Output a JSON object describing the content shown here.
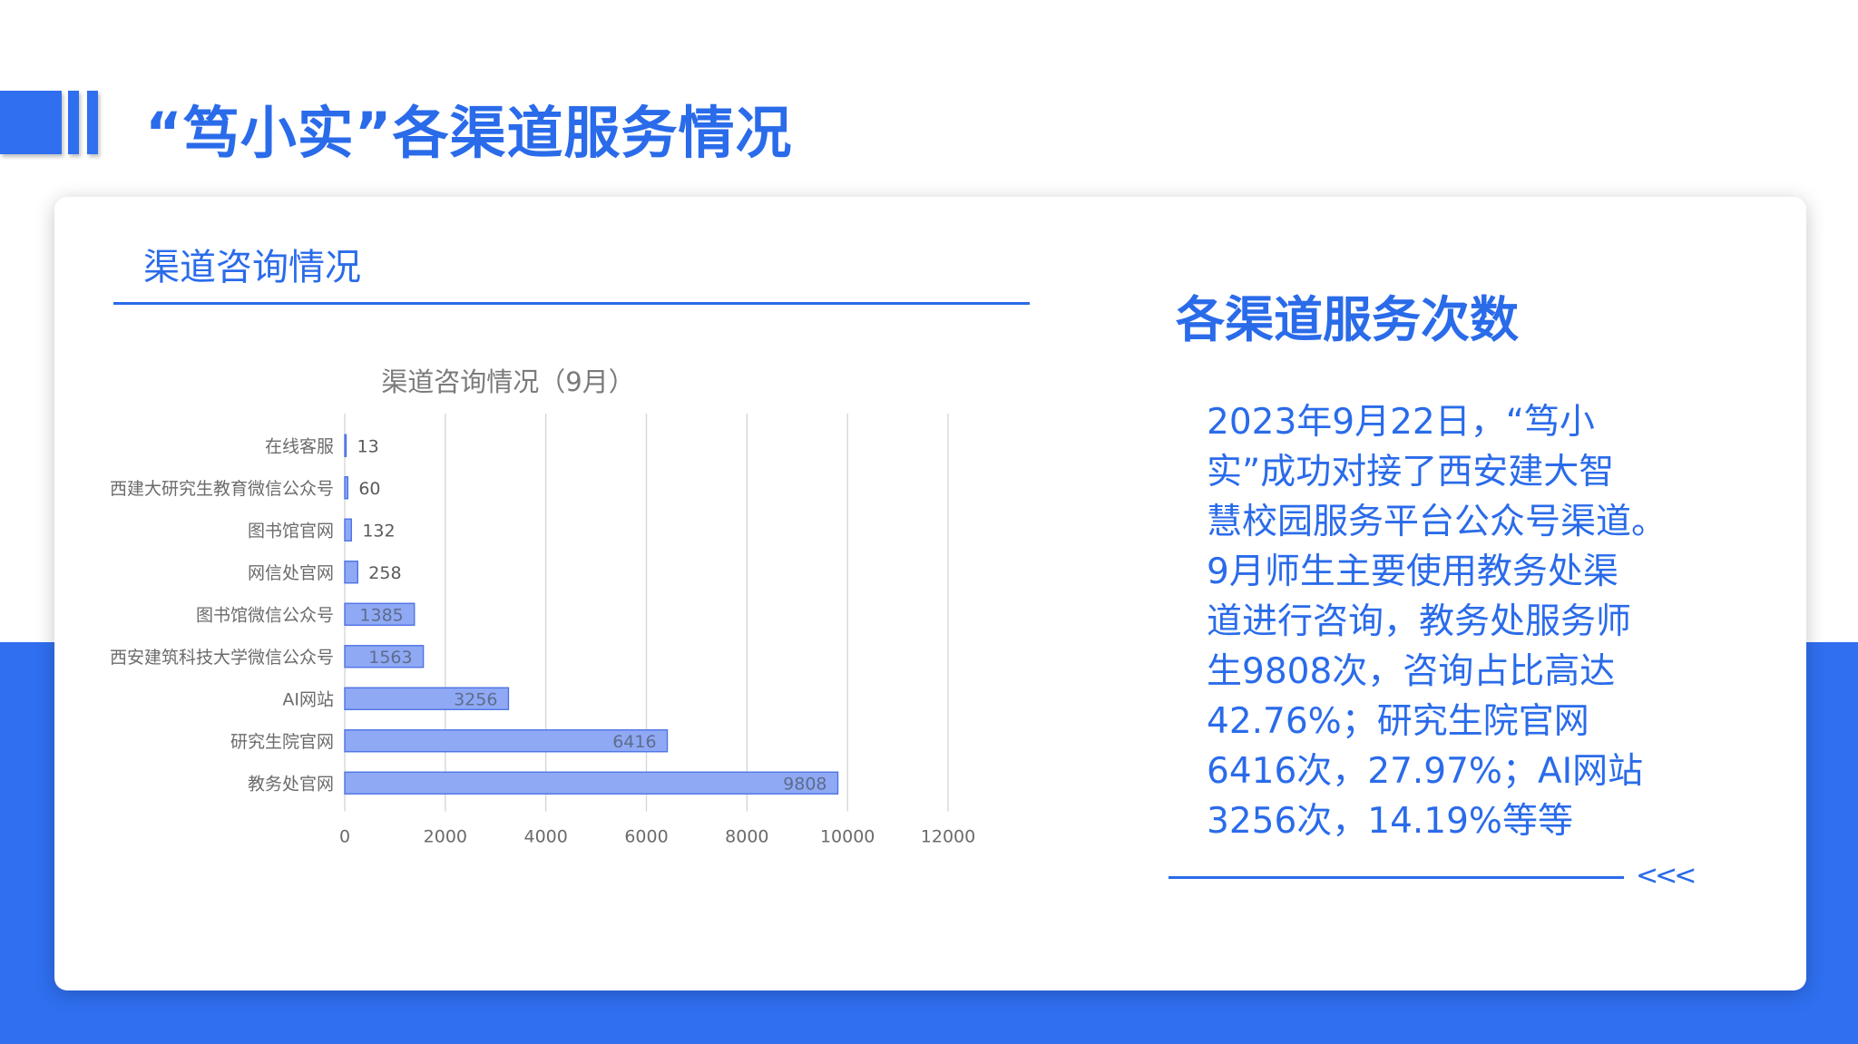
{
  "page": {
    "title": "“笃小实”各渠道服务情况"
  },
  "left_panel": {
    "section_title": "渠道咨询情况"
  },
  "right_panel": {
    "heading": "各渠道服务次数",
    "description_lines": [
      "2023年9月22日，“笃小",
      "实”成功对接了西安建大智",
      "慧校园服务平台公众号渠道。",
      "9月师生主要使用教务处渠",
      "道进行咨询，教务处服务师",
      "生9808次，咨询占比高达",
      "42.76%；研究生院官网",
      "6416次，27.97%；AI网站",
      "3256次，14.19%等等"
    ],
    "arrow_glyph": "<<<"
  },
  "colors": {
    "brand_blue": "#2f6ff0",
    "text_blue": "#2a6bea",
    "bar_fill": "#8fa9f5",
    "bar_stroke": "#4e74e6"
  },
  "chart_data": {
    "type": "bar",
    "orientation": "horizontal",
    "title": "渠道咨询情况（9月）",
    "categories": [
      "在线客服",
      "西建大研究生教育微信公众号",
      "图书馆官网",
      "网信处官网",
      "图书馆微信公众号",
      "西安建筑科技大学微信公众号",
      "AI网站",
      "研究生院官网",
      "教务处官网"
    ],
    "values": [
      13,
      60,
      132,
      258,
      1385,
      1563,
      3256,
      6416,
      9808
    ],
    "data_labels": [
      "13",
      "60",
      "132",
      "258",
      "1385",
      "1563",
      "3256",
      "6416",
      "9808"
    ],
    "xlim": [
      0,
      12000
    ],
    "x_ticks": [
      "0",
      "2000",
      "4000",
      "6000",
      "8000",
      "10000",
      "12000"
    ],
    "xlabel": "",
    "ylabel": "",
    "grid": "vertical",
    "legend": "none"
  }
}
